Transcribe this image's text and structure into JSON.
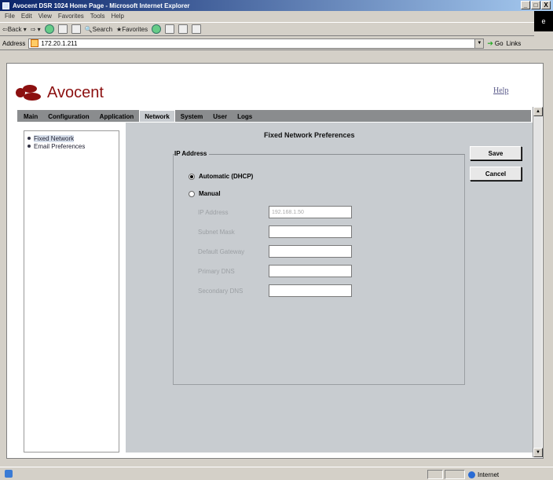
{
  "window": {
    "title": "Avocent DSR 1024 Home Page - Microsoft Internet Explorer",
    "controls": [
      "_",
      "□",
      "X"
    ]
  },
  "browser": {
    "menu": [
      "File",
      "Edit",
      "View",
      "Favorites",
      "Tools",
      "Help"
    ],
    "toolbar": {
      "back_label": "Back",
      "search_label": "Search",
      "favorites_label": "Favorites"
    },
    "address_label": "Address",
    "address_value": "172.20.1.211",
    "go_label": "Go",
    "links_label": "Links"
  },
  "header": {
    "logo_text": "Avocent",
    "help_link": "Help"
  },
  "tabs": [
    "Main",
    "Configuration",
    "Application",
    "Network",
    "System",
    "User",
    "Logs"
  ],
  "active_tab": "Network",
  "sidebar": {
    "items": [
      "Fixed Network",
      "Email Preferences"
    ],
    "selected": "Fixed Network"
  },
  "main": {
    "title": "Fixed Network Preferences",
    "group_label": "IP Address",
    "radio_automatic": "Automatic (DHCP)",
    "radio_manual": "Manual",
    "automatic_selected": true,
    "fields": [
      {
        "label": "IP Address",
        "value": "192.168.1.50"
      },
      {
        "label": "Subnet Mask",
        "value": ""
      },
      {
        "label": "Default Gateway",
        "value": ""
      },
      {
        "label": "Primary DNS",
        "value": ""
      },
      {
        "label": "Secondary DNS",
        "value": ""
      }
    ],
    "save_label": "Save",
    "cancel_label": "Cancel"
  },
  "status": {
    "zone": "Internet"
  }
}
